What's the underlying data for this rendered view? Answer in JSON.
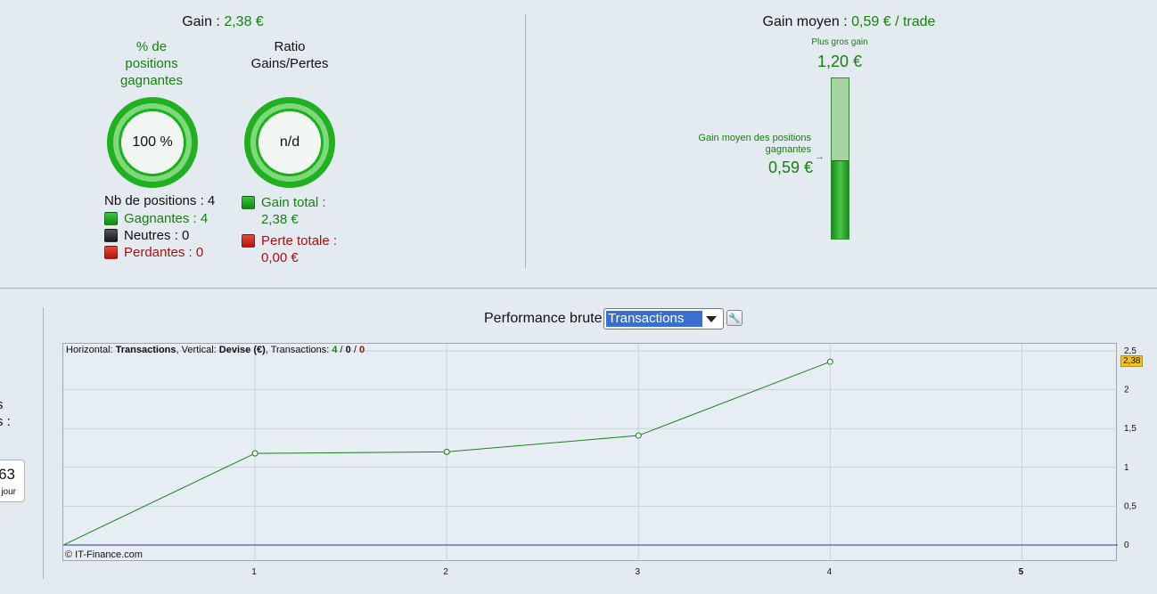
{
  "top_left": {
    "gain_label": "Gain : ",
    "gain_value": "2,38 €",
    "pct_win_label_lines": [
      "% de",
      "positions",
      "gagnantes"
    ],
    "pct_win_value": "100 %",
    "ratio_label_lines": [
      "Ratio",
      "Gains/Pertes"
    ],
    "ratio_value": "n/d",
    "nb_positions_label": "Nb de positions : ",
    "nb_positions_value": "4",
    "winning": "Gagnantes : 4",
    "neutral": "Neutres : 0",
    "losing": "Perdantes : 0",
    "total_gain_label": "Gain total :",
    "total_gain_value": "2,38 €",
    "total_loss_label": "Perte totale :",
    "total_loss_value": "0,00 €"
  },
  "top_right": {
    "avg_gain_label": "Gain moyen : ",
    "avg_gain_value": "0,59 € / trade",
    "best_gain_label": "Plus gros gain",
    "best_gain_value": "1,20 €",
    "avg_win_label_lines": [
      "Gain moyen des positions",
      "gagnantes"
    ],
    "avg_win_value": "0,59 €",
    "bar_fill_fraction": 0.49
  },
  "left_partial": {
    "line1": "s",
    "line2": "s :",
    "card_value": "63",
    "card_label": "jour"
  },
  "performance": {
    "title": "Performance brute",
    "select_value": "Transactions",
    "tool_icon": "wrench-icon"
  },
  "chart_info": {
    "horizontal_label": "Horizontal: ",
    "horizontal_value": "Transactions",
    "vertical_label": ", Vertical: ",
    "vertical_value": "Devise (€)",
    "transactions_label": ", Transactions: ",
    "tx_win": "4",
    "tx_sep1": " / ",
    "tx_neutral": "0",
    "tx_sep2": " / ",
    "tx_loss": "0",
    "copyright": "© IT-Finance.com",
    "last_value_badge": "2,38"
  },
  "chart_data": {
    "type": "line",
    "x": [
      0,
      1,
      2,
      3,
      4
    ],
    "series": [
      {
        "values": [
          0,
          1.18,
          1.2,
          1.41,
          2.36
        ],
        "color": "#1a7f1a"
      }
    ],
    "xticks": [
      "1",
      "2",
      "3",
      "4",
      "5"
    ],
    "yticks": [
      "0",
      "0,5",
      "1",
      "1,5",
      "2",
      "2,5"
    ],
    "xlim": [
      0,
      5.5
    ],
    "ylim": [
      0,
      2.5
    ],
    "baseline_color": "#2431b6",
    "grid": true
  },
  "colors": {
    "green": "#17800f",
    "red": "#b00d0d",
    "badge": "#f1c40f"
  }
}
